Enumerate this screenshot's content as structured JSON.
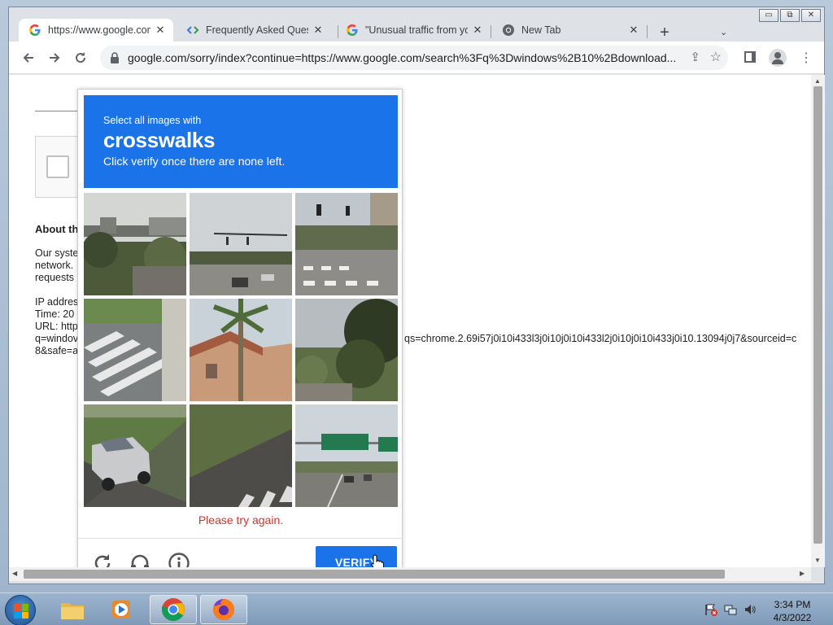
{
  "window": {
    "controls": [
      "▭",
      "⧉",
      "✕"
    ]
  },
  "tabs": [
    {
      "title": "https://www.google.com",
      "favicon": "google-g-icon",
      "active": true
    },
    {
      "title": "Frequently Asked Questi",
      "favicon": "code-brackets-icon",
      "active": false
    },
    {
      "title": "\"Unusual traffic from yo",
      "favicon": "google-g-icon",
      "active": false
    },
    {
      "title": "New Tab",
      "favicon": "chrome-icon",
      "active": false
    }
  ],
  "toolbar": {
    "url": "google.com/sorry/index?continue=https://www.google.com/search%3Fq%3Dwindows%2B10%2Bdownload..."
  },
  "page": {
    "about_heading": "About th",
    "para_lines": [
      "Our syste",
      "network.",
      "requests"
    ],
    "ip_line": "IP addres",
    "time_line": "Time: 20",
    "url_line": "URL: http",
    "q_line": "q=windov",
    "safe_line": "8&safe=a",
    "url_tail": "qs=chrome.2.69i57j0i10i433l3j0i10j0i10i433l2j0i10j0i10i433j0i10.13094j0j7&sourceid=c"
  },
  "captcha": {
    "instruction": "Select all images with",
    "target": "crosswalks",
    "subtext": "Click verify once there are none left.",
    "error": "Please try again.",
    "verify_label": "VERIFY",
    "tiles": [
      "overpass-sign",
      "intersection",
      "city-crosswalk",
      "crosswalk-closeup",
      "tile-roof-palm",
      "trees-road",
      "silver-car",
      "road-edge-stripes",
      "highway-signs"
    ]
  },
  "taskbar": {
    "clock_time": "3:34 PM",
    "clock_date": "4/3/2022",
    "apps": [
      "file-explorer",
      "media-player",
      "chrome",
      "firefox"
    ]
  },
  "colors": {
    "accent": "#1a73e8",
    "error": "#d93025"
  }
}
